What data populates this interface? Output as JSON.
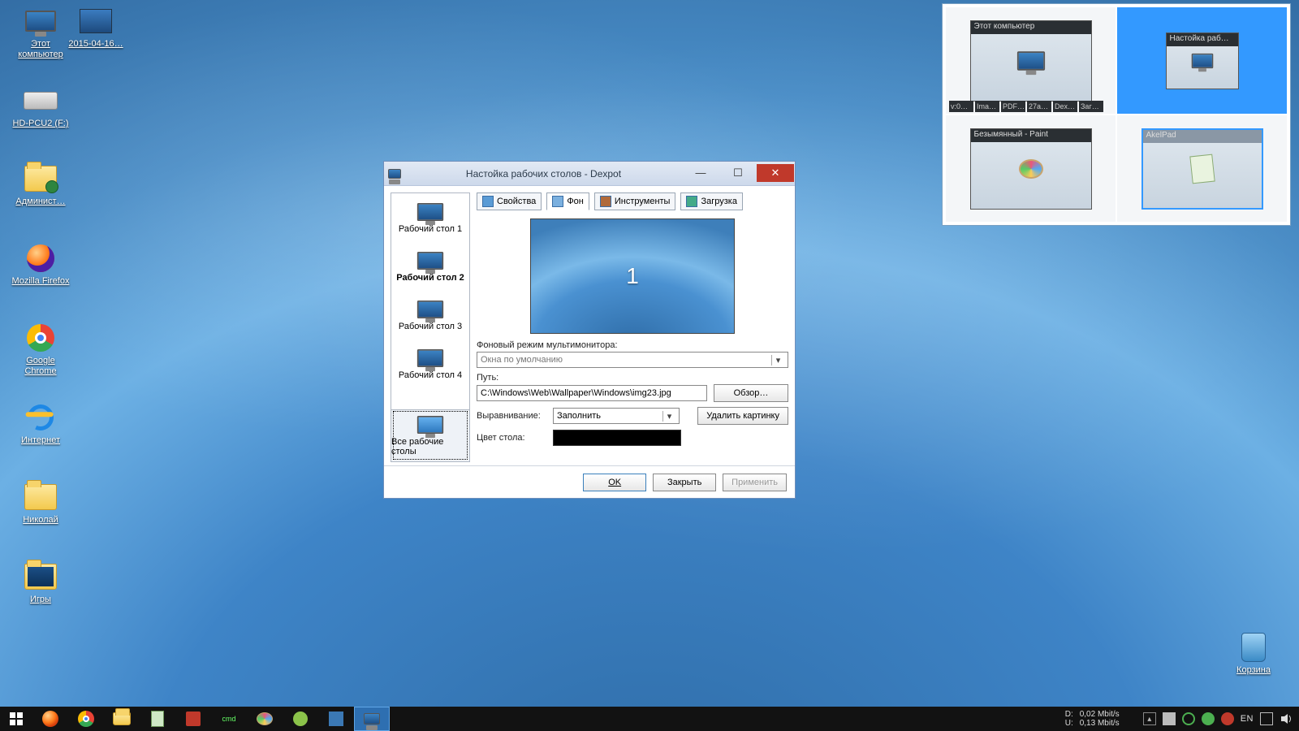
{
  "desktop_icons": {
    "this_pc": "Этот компьютер",
    "screenshot_file": "2015-04-16…",
    "ext_drive": "HD-PCU2 (F:)",
    "admin": "Админист…",
    "firefox": "Mozilla Firefox",
    "chrome": "Google Chrome",
    "internet": "Интернет",
    "user_folder": "Николай",
    "games": "Игры",
    "recycle": "Корзина"
  },
  "overview": {
    "d1": {
      "title": "Этот компьютер",
      "tasks": [
        "v:0…",
        "Ima…",
        "PDF…",
        "27a…",
        "Dex…",
        "Заг…"
      ]
    },
    "d2": {
      "title": "Настойка раб…"
    },
    "d3": {
      "title": "Безымянный - Paint"
    },
    "d4": {
      "title": "AkelPad"
    }
  },
  "dlg": {
    "title": "Настойка рабочих столов - Dexpot",
    "side": {
      "d1": "Рабочий стол 1",
      "d2": "Рабочий стол 2",
      "d3": "Рабочий стол 3",
      "d4": "Рабочий стол 4",
      "all": "Все рабочие столы"
    },
    "tabs": {
      "properties": "Свойства",
      "background": "Фон",
      "tools": "Инструменты",
      "startup": "Загрузка"
    },
    "preview_number": "1",
    "multimon_label": "Фоновый режим мультимонитора:",
    "multimon_value": "Окна по умолчанию",
    "path_label": "Путь:",
    "path_value": "C:\\Windows\\Web\\Wallpaper\\Windows\\img23.jpg",
    "browse": "Обзор…",
    "align_label": "Выравнивание:",
    "align_value": "Заполнить",
    "remove_image": "Удалить картинку",
    "color_label": "Цвет стола:",
    "color_value": "#000000",
    "ok": "OK",
    "close": "Закрыть",
    "apply": "Применить"
  },
  "taskbar": {
    "net": {
      "d_label": "D:",
      "u_label": "U:",
      "d_rate": "0,02 Mbit/s",
      "u_rate": "0,13 Mbit/s"
    },
    "lang": "EN"
  }
}
